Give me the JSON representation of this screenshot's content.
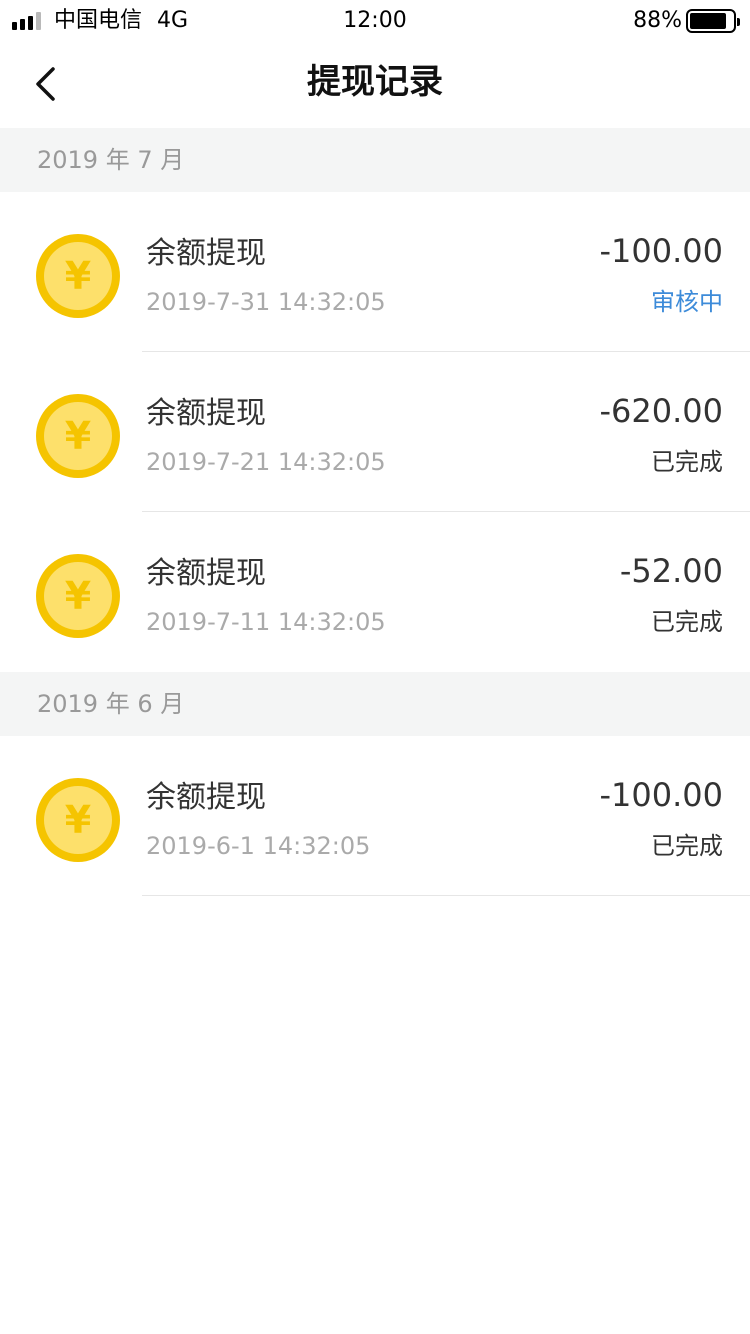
{
  "status_bar": {
    "carrier": "中国电信",
    "network": "4G",
    "time": "12:00",
    "battery": "88%",
    "battery_level": 0.88
  },
  "nav": {
    "title": "提现记录",
    "back_icon": "chevron-left-icon"
  },
  "sections": [
    {
      "header": "2019 年 7 月",
      "records": [
        {
          "title": "余额提现",
          "time": "2019-7-31 14:32:05",
          "amount": "-100.00",
          "status": "审核中",
          "status_type": "pending"
        },
        {
          "title": "余额提现",
          "time": "2019-7-21 14:32:05",
          "amount": "-620.00",
          "status": "已完成",
          "status_type": "done"
        },
        {
          "title": "余额提现",
          "time": "2019-7-11 14:32:05",
          "amount": "-52.00",
          "status": "已完成",
          "status_type": "done"
        }
      ]
    },
    {
      "header": "2019 年 6 月",
      "records": [
        {
          "title": "余额提现",
          "time": "2019-6-1 14:32:05",
          "amount": "-100.00",
          "status": "已完成",
          "status_type": "done"
        }
      ]
    }
  ],
  "colors": {
    "coin_outer": "#f5c400",
    "coin_inner": "#fde06b",
    "pending": "#3d8bd9",
    "section_bg": "#f4f5f5"
  }
}
